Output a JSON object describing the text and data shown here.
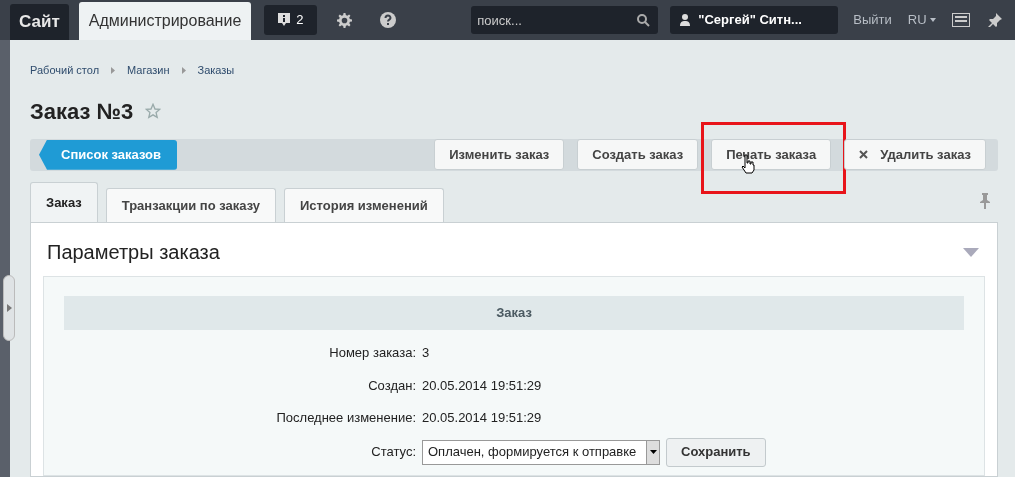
{
  "top_bar": {
    "tabs": [
      {
        "label": "Сайт",
        "selected": false
      },
      {
        "label": "Администрирование",
        "selected": true
      }
    ],
    "notifications": {
      "count": "2"
    },
    "search": {
      "placeholder": "поиск..."
    },
    "user": {
      "name": "\"Сергей\" Ситн..."
    },
    "logout": "Выйти",
    "language": "RU"
  },
  "breadcrumbs": [
    "Рабочий стол",
    "Магазин",
    "Заказы"
  ],
  "title": "Заказ №3",
  "toolbar": {
    "back_button": "Список заказов",
    "buttons": [
      {
        "label": "Изменить заказ",
        "kind": "plain",
        "highlighted": false
      },
      {
        "label": "Создать заказ",
        "kind": "plain",
        "highlighted": false
      },
      {
        "label": "Печать заказа",
        "kind": "plain",
        "highlighted": true
      },
      {
        "label": "Удалить заказ",
        "kind": "delete",
        "highlighted": false
      }
    ]
  },
  "tabs": [
    {
      "label": "Заказ",
      "selected": true
    },
    {
      "label": "Транзакции по заказу",
      "selected": false
    },
    {
      "label": "История изменений",
      "selected": false
    }
  ],
  "section": {
    "title": "Параметры заказа",
    "group_title": "Заказ",
    "fields": [
      {
        "label": "Номер заказа:",
        "value": "3"
      },
      {
        "label": "Создан:",
        "value": "20.05.2014 19:51:29"
      },
      {
        "label": "Последнее изменение:",
        "value": "20.05.2014 19:51:29"
      }
    ],
    "status": {
      "label": "Статус:",
      "value": "Оплачен, формируется к отправке",
      "save_button": "Сохранить"
    }
  }
}
